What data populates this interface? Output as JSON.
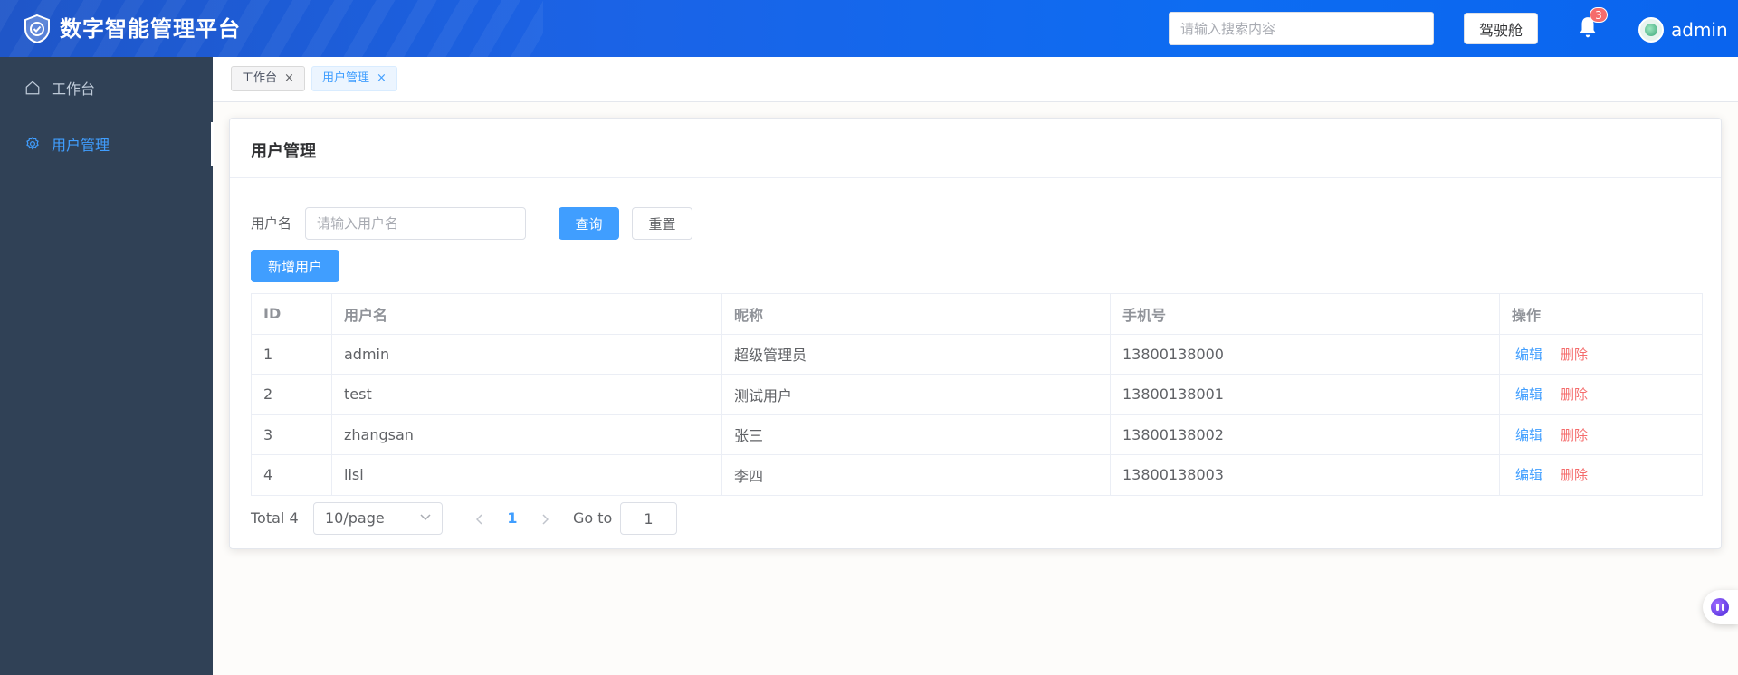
{
  "header": {
    "app_title": "数字智能管理平台",
    "search_placeholder": "请输入搜索内容",
    "cockpit_label": "驾驶舱",
    "notification_count": "3",
    "user_name": "admin"
  },
  "sidebar": {
    "items": [
      {
        "label": "工作台",
        "icon": "home-icon",
        "active": false
      },
      {
        "label": "用户管理",
        "icon": "gear-icon",
        "active": true
      }
    ]
  },
  "tags": [
    {
      "label": "工作台",
      "active": false
    },
    {
      "label": "用户管理",
      "active": true
    }
  ],
  "card": {
    "title": "用户管理",
    "filter_label": "用户名",
    "filter_placeholder": "请输入用户名",
    "query_label": "查询",
    "reset_label": "重置",
    "add_label": "新增用户"
  },
  "table": {
    "columns": [
      "ID",
      "用户名",
      "昵称",
      "手机号",
      "操作"
    ],
    "rows": [
      [
        "1",
        "admin",
        "超级管理员",
        "13800138000"
      ],
      [
        "2",
        "test",
        "测试用户",
        "13800138001"
      ],
      [
        "3",
        "zhangsan",
        "张三",
        "13800138002"
      ],
      [
        "4",
        "lisi",
        "李四",
        "13800138003"
      ]
    ],
    "edit_label": "编辑",
    "delete_label": "删除"
  },
  "pagination": {
    "total": "Total 4",
    "page_size": "10/page",
    "current_page": "1",
    "goto_label": "Go to",
    "goto_value": "1"
  },
  "colors": {
    "primary": "#409eff",
    "danger": "#f56c6c",
    "sidebar_bg": "#304156",
    "header_bg": "#1b63e6"
  }
}
